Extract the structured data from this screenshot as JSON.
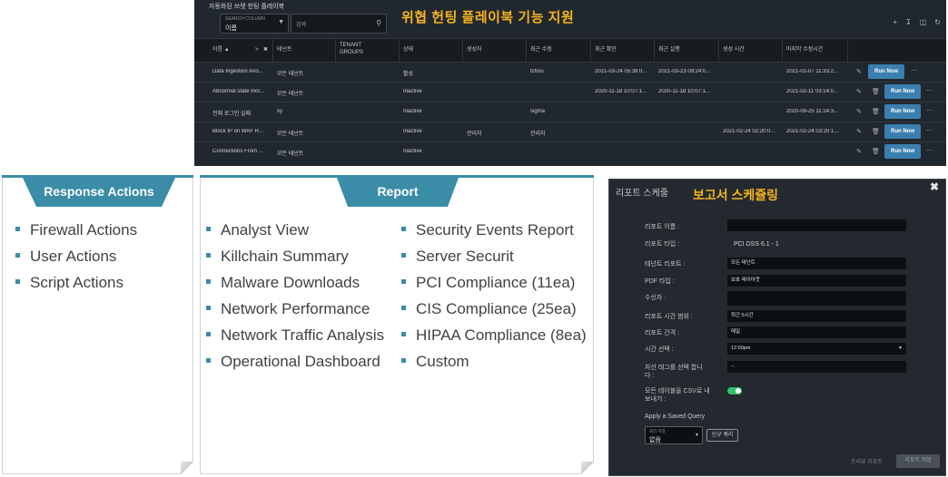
{
  "playbook": {
    "title": "자동화된 쓰렛 헌팅 플레이북",
    "banner": "위협 헌팅 플레이북 기능 지원",
    "search_column_label": "SEARCH COLUMN",
    "search_column_value": "이름",
    "search_placeholder": "검색",
    "columns": {
      "name": "이름 ▲",
      "tenant": "테넌트",
      "tenant_groups_1": "TENANT",
      "tenant_groups_2": "GROUPS",
      "status": "상태",
      "creator": "생성자",
      "modifier": "최근 수정",
      "last_checked": "최근 확인",
      "last_run": "최근 실행",
      "created_time": "생성 시간",
      "last_modified": "마지막 수정시간"
    },
    "run_label": "Run Now",
    "rows": [
      {
        "name": "Data Ingestion Ano...",
        "tenant": "모든 테넌트",
        "status": "활성",
        "creator": "",
        "modifier": "tchou",
        "last_checked": "2021-03-24 05:39:0...",
        "last_run": "2021-03-23 09:24:0...",
        "created_time": "",
        "last_modified": "2021-01-07 11:33:2..."
      },
      {
        "name": "Abnormal state mor...",
        "tenant": "모든 테넌트",
        "status": "Inactive",
        "creator": "",
        "modifier": "",
        "last_checked": "2020-11-18 10:07:1...",
        "last_run": "2020-11-18 10:07:1...",
        "created_time": "",
        "last_modified": "2021-02-11 03:14:0..."
      },
      {
        "name": "전체 로그인 실패",
        "tenant": "xy",
        "status": "Inactive",
        "creator": "",
        "modifier": "sigma",
        "last_checked": "",
        "last_run": "",
        "created_time": "",
        "last_modified": "2020-09-25 11:14:3..."
      },
      {
        "name": "Block IP on WAF R...",
        "tenant": "모든 테넌트",
        "status": "Inactive",
        "creator": "관리자",
        "modifier": "관리자",
        "last_checked": "",
        "last_run": "",
        "created_time": "2021-02-24 02:20:0...",
        "last_modified": "2021-02-24 03:20:1..."
      },
      {
        "name": "Connections From ...",
        "tenant": "모든 테넌트",
        "status": "Inactive",
        "creator": "",
        "modifier": "",
        "last_checked": "",
        "last_run": "",
        "created_time": "",
        "last_modified": ""
      }
    ]
  },
  "response_actions": {
    "title": "Response Actions",
    "items": [
      "Firewall Actions",
      "User Actions",
      "Script Actions"
    ]
  },
  "report": {
    "title": "Report",
    "left_items": [
      "Analyst View",
      "Killchain Summary",
      "Malware Downloads",
      "Network Performance",
      "Network Traffic Analysis",
      "Operational Dashboard"
    ],
    "right_items": [
      "Security Events Report",
      "Server Securit",
      "PCI Compliance (11ea)",
      "CIS Compliance (25ea)",
      "HIPAA Compliance (8ea)",
      "Custom"
    ]
  },
  "schedule": {
    "title": "리포트 스케줄",
    "highlight": "보고서 스케쥴링",
    "close": "✖",
    "report_name_label": "리포트 이름 :",
    "report_type_label": "리포트 타입 :",
    "report_type_value": "PCI DSS 6.1 - 1",
    "tenant_report_label": "테넌트 리포트 :",
    "tenant_report_value": "모든 테넌트",
    "pdf_type_label": "PDF 타입 :",
    "pdf_type_value": "보호 레이아웃",
    "recipient_label": "수신자 :",
    "time_range_label": "리포트 시간 범위 :",
    "time_range_value": "최근 5시간",
    "interval_label": "리포트 간격 :",
    "interval_value": "매일",
    "time_select_label": "시간 선택 :",
    "time_select_value": "12:00pm",
    "asset_tag_label_1": "자산 태그를 선택 합니",
    "asset_tag_label_2": "다 :",
    "asset_tag_value": "--",
    "csv_label_1": "모든 테이블을 CSV로 내",
    "csv_label_2": "보내기 :",
    "csv_enabled": true,
    "saved_query_label": "Apply a Saved Query",
    "query_select_label": "쿼리 저장",
    "query_select_value": "없음",
    "new_query_button": "신규 쿼리",
    "preview_button": "프리뷰 리포트",
    "save_button": "리포트 저장"
  }
}
